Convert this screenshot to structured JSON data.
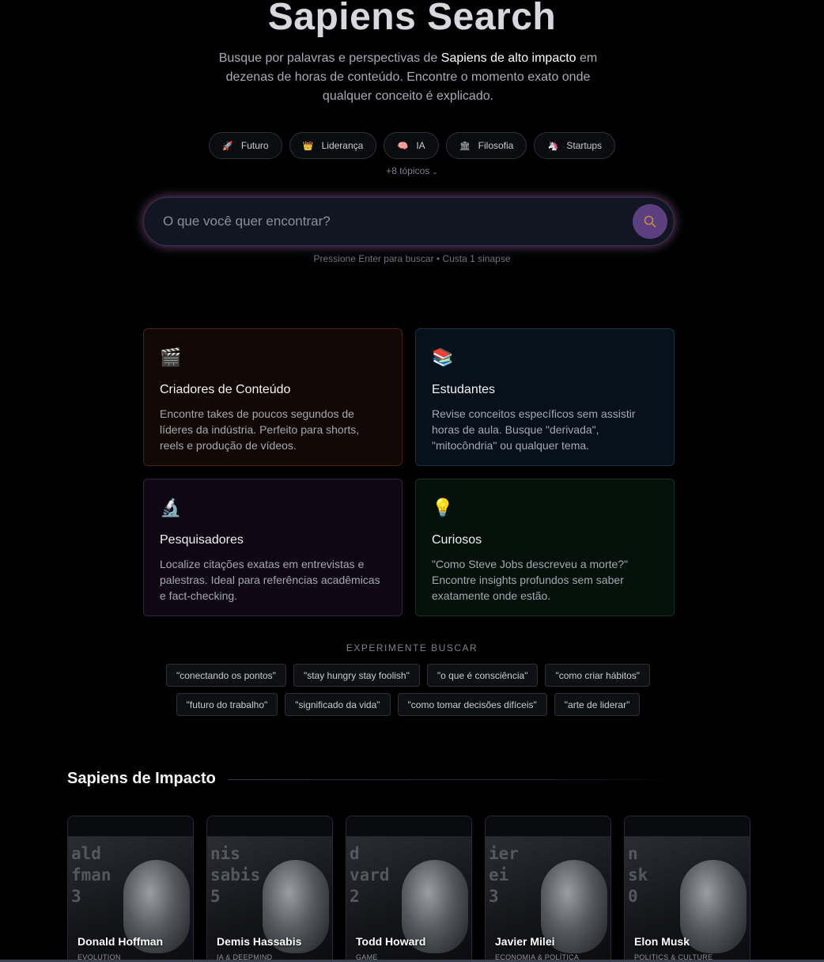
{
  "hero": {
    "title": "Sapiens Search",
    "subtitle_pre": "Busque por palavras e perspectivas de ",
    "subtitle_highlight": "Sapiens de alto impacto",
    "subtitle_post": " em dezenas de horas de conteúdo. Encontre o momento exato onde qualquer conceito é explicado."
  },
  "topics": [
    {
      "icon": "rocket-icon",
      "glyph": "🚀",
      "label": "Futuro"
    },
    {
      "icon": "crown-icon",
      "glyph": "👑",
      "label": "Liderança"
    },
    {
      "icon": "brain-icon",
      "glyph": "🧠",
      "label": "IA"
    },
    {
      "icon": "classical-building-icon",
      "glyph": "🏛",
      "label": "Filosofia"
    },
    {
      "icon": "unicorn-icon",
      "glyph": "🦄",
      "label": "Startups"
    }
  ],
  "more_topics": "+8 tópicos",
  "search": {
    "placeholder": "O que você quer encontrar?",
    "hint": "Pressione Enter para buscar • Custa 1 sinapse",
    "accent": "#5b3f7e"
  },
  "cards": [
    {
      "icon": "clapper-board-icon",
      "glyph": "🎬",
      "title": "Criadores de Conteúdo",
      "desc": "Encontre takes de poucos segundos de líderes da indústria. Perfeito para shorts, reels e produção de vídeos."
    },
    {
      "icon": "books-icon",
      "glyph": "📚",
      "title": "Estudantes",
      "desc": "Revise conceitos específicos sem assistir horas de aula. Busque \"derivada\", \"mitocôndria\" ou qualquer tema."
    },
    {
      "icon": "microscope-icon",
      "glyph": "🔬",
      "title": "Pesquisadores",
      "desc": "Localize citações exatas em entrevistas e palestras. Ideal para referências acadêmicas e fact-checking."
    },
    {
      "icon": "light-bulb-icon",
      "glyph": "💡",
      "title": "Curiosos",
      "desc": "\"Como Steve Jobs descreveu a morte?\" Encontre insights profundos sem saber exatamente onde estão."
    }
  ],
  "try_search": {
    "title": "EXPERIMENTE BUSCAR",
    "row1": [
      "\"conectando os pontos\"",
      "\"stay hungry stay foolish\"",
      "\"o que é consciência\"",
      "\"como criar hábitos\""
    ],
    "row2": [
      "\"futuro do trabalho\"",
      "\"significado da vida\"",
      "\"como tomar decisões difíceis\"",
      "\"arte de liderar\""
    ]
  },
  "impact": {
    "title": "Sapiens de Impacto",
    "people": [
      {
        "name": "Donald Hoffman",
        "category": "EVOLUTION",
        "bg": "ald\nfman\n3"
      },
      {
        "name": "Demis Hassabis",
        "category": "IA & DEEPMIND",
        "bg": "nis\nsabis\n5"
      },
      {
        "name": "Todd Howard",
        "category": "GAME",
        "bg": "d\nvard\n2"
      },
      {
        "name": "Javier Milei",
        "category": "ECONOMIA & POLÍTICA",
        "bg": "ier\nei\n3"
      },
      {
        "name": "Elon Musk",
        "category": "POLITICS & CULTURE",
        "bg": "n\nsk\n0"
      }
    ]
  }
}
